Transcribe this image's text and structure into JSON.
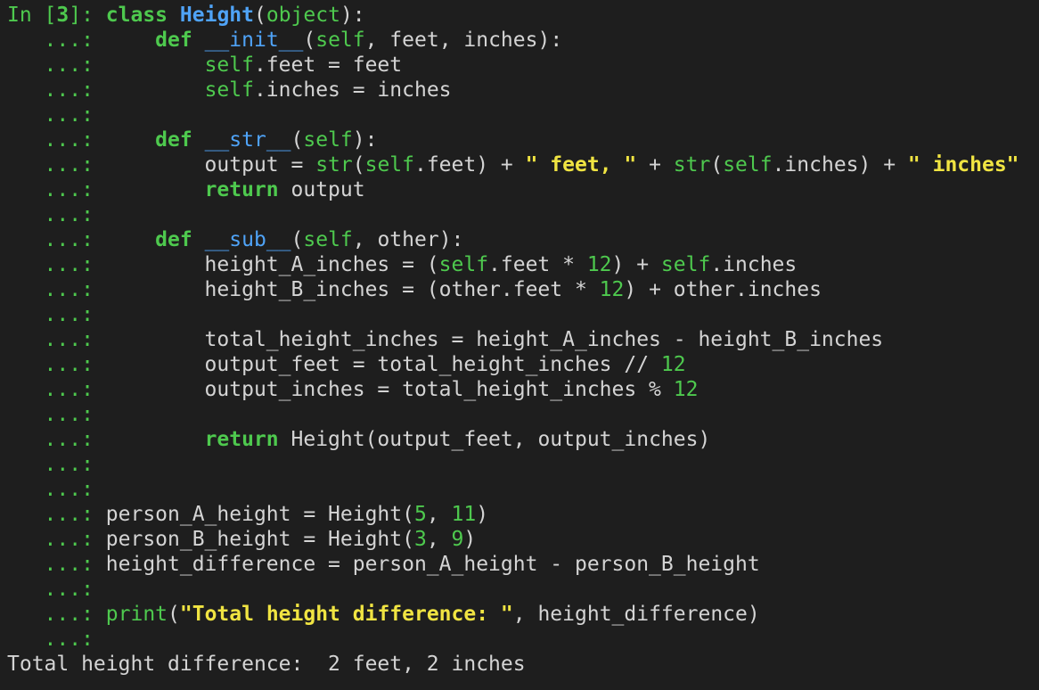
{
  "colors": {
    "background": "#1e1e1e",
    "text": "#d4d4d4",
    "prompt": "#4ec94e",
    "keyword": "#4ec94e",
    "class_name": "#4fa3f7",
    "string": "#f0e442",
    "number": "#4ec94e"
  },
  "lines": [
    {
      "kind": "code",
      "tokens": [
        {
          "t": "In [",
          "c": "in-prompt"
        },
        {
          "t": "3",
          "c": "in-num"
        },
        {
          "t": "]: ",
          "c": "in-prompt"
        },
        {
          "t": "class",
          "c": "kw"
        },
        {
          "t": " ",
          "c": "plain"
        },
        {
          "t": "Height",
          "c": "cls"
        },
        {
          "t": "(",
          "c": "plain"
        },
        {
          "t": "object",
          "c": "builtin"
        },
        {
          "t": "):",
          "c": "plain"
        }
      ]
    },
    {
      "kind": "code",
      "tokens": [
        {
          "t": "   ...: ",
          "c": "cont"
        },
        {
          "t": "    ",
          "c": "plain"
        },
        {
          "t": "def",
          "c": "kw"
        },
        {
          "t": " ",
          "c": "plain"
        },
        {
          "t": "__init__",
          "c": "fn"
        },
        {
          "t": "(",
          "c": "plain"
        },
        {
          "t": "self",
          "c": "self"
        },
        {
          "t": ", feet, inches):",
          "c": "plain"
        }
      ]
    },
    {
      "kind": "code",
      "tokens": [
        {
          "t": "   ...: ",
          "c": "cont"
        },
        {
          "t": "        ",
          "c": "plain"
        },
        {
          "t": "self",
          "c": "self"
        },
        {
          "t": ".feet = feet",
          "c": "plain"
        }
      ]
    },
    {
      "kind": "code",
      "tokens": [
        {
          "t": "   ...: ",
          "c": "cont"
        },
        {
          "t": "        ",
          "c": "plain"
        },
        {
          "t": "self",
          "c": "self"
        },
        {
          "t": ".inches = inches",
          "c": "plain"
        }
      ]
    },
    {
      "kind": "code",
      "tokens": [
        {
          "t": "   ...:",
          "c": "cont"
        }
      ]
    },
    {
      "kind": "code",
      "tokens": [
        {
          "t": "   ...: ",
          "c": "cont"
        },
        {
          "t": "    ",
          "c": "plain"
        },
        {
          "t": "def",
          "c": "kw"
        },
        {
          "t": " ",
          "c": "plain"
        },
        {
          "t": "__str__",
          "c": "fn"
        },
        {
          "t": "(",
          "c": "plain"
        },
        {
          "t": "self",
          "c": "self"
        },
        {
          "t": "):",
          "c": "plain"
        }
      ]
    },
    {
      "kind": "code",
      "tokens": [
        {
          "t": "   ...: ",
          "c": "cont"
        },
        {
          "t": "        output = ",
          "c": "plain"
        },
        {
          "t": "str",
          "c": "builtin"
        },
        {
          "t": "(",
          "c": "plain"
        },
        {
          "t": "self",
          "c": "self"
        },
        {
          "t": ".feet) + ",
          "c": "plain"
        },
        {
          "t": "\" feet, \"",
          "c": "str"
        },
        {
          "t": " + ",
          "c": "plain"
        },
        {
          "t": "str",
          "c": "builtin"
        },
        {
          "t": "(",
          "c": "plain"
        },
        {
          "t": "self",
          "c": "self"
        },
        {
          "t": ".inches) + ",
          "c": "plain"
        },
        {
          "t": "\" inches\"",
          "c": "str"
        }
      ]
    },
    {
      "kind": "code",
      "tokens": [
        {
          "t": "   ...: ",
          "c": "cont"
        },
        {
          "t": "        ",
          "c": "plain"
        },
        {
          "t": "return",
          "c": "kw"
        },
        {
          "t": " output",
          "c": "plain"
        }
      ]
    },
    {
      "kind": "code",
      "tokens": [
        {
          "t": "   ...:",
          "c": "cont"
        }
      ]
    },
    {
      "kind": "code",
      "tokens": [
        {
          "t": "   ...: ",
          "c": "cont"
        },
        {
          "t": "    ",
          "c": "plain"
        },
        {
          "t": "def",
          "c": "kw"
        },
        {
          "t": " ",
          "c": "plain"
        },
        {
          "t": "__sub__",
          "c": "fn"
        },
        {
          "t": "(",
          "c": "plain"
        },
        {
          "t": "self",
          "c": "self"
        },
        {
          "t": ", other):",
          "c": "plain"
        }
      ]
    },
    {
      "kind": "code",
      "tokens": [
        {
          "t": "   ...: ",
          "c": "cont"
        },
        {
          "t": "        height_A_inches = (",
          "c": "plain"
        },
        {
          "t": "self",
          "c": "self"
        },
        {
          "t": ".feet * ",
          "c": "plain"
        },
        {
          "t": "12",
          "c": "num"
        },
        {
          "t": ") + ",
          "c": "plain"
        },
        {
          "t": "self",
          "c": "self"
        },
        {
          "t": ".inches",
          "c": "plain"
        }
      ]
    },
    {
      "kind": "code",
      "tokens": [
        {
          "t": "   ...: ",
          "c": "cont"
        },
        {
          "t": "        height_B_inches = (other.feet * ",
          "c": "plain"
        },
        {
          "t": "12",
          "c": "num"
        },
        {
          "t": ") + other.inches",
          "c": "plain"
        }
      ]
    },
    {
      "kind": "code",
      "tokens": [
        {
          "t": "   ...:",
          "c": "cont"
        }
      ]
    },
    {
      "kind": "code",
      "tokens": [
        {
          "t": "   ...: ",
          "c": "cont"
        },
        {
          "t": "        total_height_inches = height_A_inches - height_B_inches",
          "c": "plain"
        }
      ]
    },
    {
      "kind": "code",
      "tokens": [
        {
          "t": "   ...: ",
          "c": "cont"
        },
        {
          "t": "        output_feet = total_height_inches // ",
          "c": "plain"
        },
        {
          "t": "12",
          "c": "num"
        }
      ]
    },
    {
      "kind": "code",
      "tokens": [
        {
          "t": "   ...: ",
          "c": "cont"
        },
        {
          "t": "        output_inches = total_height_inches % ",
          "c": "plain"
        },
        {
          "t": "12",
          "c": "num"
        }
      ]
    },
    {
      "kind": "code",
      "tokens": [
        {
          "t": "   ...:",
          "c": "cont"
        }
      ]
    },
    {
      "kind": "code",
      "tokens": [
        {
          "t": "   ...: ",
          "c": "cont"
        },
        {
          "t": "        ",
          "c": "plain"
        },
        {
          "t": "return",
          "c": "kw"
        },
        {
          "t": " Height(output_feet, output_inches)",
          "c": "plain"
        }
      ]
    },
    {
      "kind": "code",
      "tokens": [
        {
          "t": "   ...:",
          "c": "cont"
        }
      ]
    },
    {
      "kind": "code",
      "tokens": [
        {
          "t": "   ...:",
          "c": "cont"
        }
      ]
    },
    {
      "kind": "code",
      "tokens": [
        {
          "t": "   ...: ",
          "c": "cont"
        },
        {
          "t": "person_A_height = Height(",
          "c": "plain"
        },
        {
          "t": "5",
          "c": "num"
        },
        {
          "t": ", ",
          "c": "plain"
        },
        {
          "t": "11",
          "c": "num"
        },
        {
          "t": ")",
          "c": "plain"
        }
      ]
    },
    {
      "kind": "code",
      "tokens": [
        {
          "t": "   ...: ",
          "c": "cont"
        },
        {
          "t": "person_B_height = Height(",
          "c": "plain"
        },
        {
          "t": "3",
          "c": "num"
        },
        {
          "t": ", ",
          "c": "plain"
        },
        {
          "t": "9",
          "c": "num"
        },
        {
          "t": ")",
          "c": "plain"
        }
      ]
    },
    {
      "kind": "code",
      "tokens": [
        {
          "t": "   ...: ",
          "c": "cont"
        },
        {
          "t": "height_difference = person_A_height - person_B_height",
          "c": "plain"
        }
      ]
    },
    {
      "kind": "code",
      "tokens": [
        {
          "t": "   ...:",
          "c": "cont"
        }
      ]
    },
    {
      "kind": "code",
      "tokens": [
        {
          "t": "   ...: ",
          "c": "cont"
        },
        {
          "t": "print",
          "c": "builtin"
        },
        {
          "t": "(",
          "c": "plain"
        },
        {
          "t": "\"Total height difference: \"",
          "c": "str"
        },
        {
          "t": ", height_difference)",
          "c": "plain"
        }
      ]
    },
    {
      "kind": "code",
      "tokens": [
        {
          "t": "   ...:",
          "c": "cont"
        }
      ]
    },
    {
      "kind": "output",
      "tokens": [
        {
          "t": "Total height difference:  2 feet, 2 inches",
          "c": "output"
        }
      ]
    }
  ]
}
